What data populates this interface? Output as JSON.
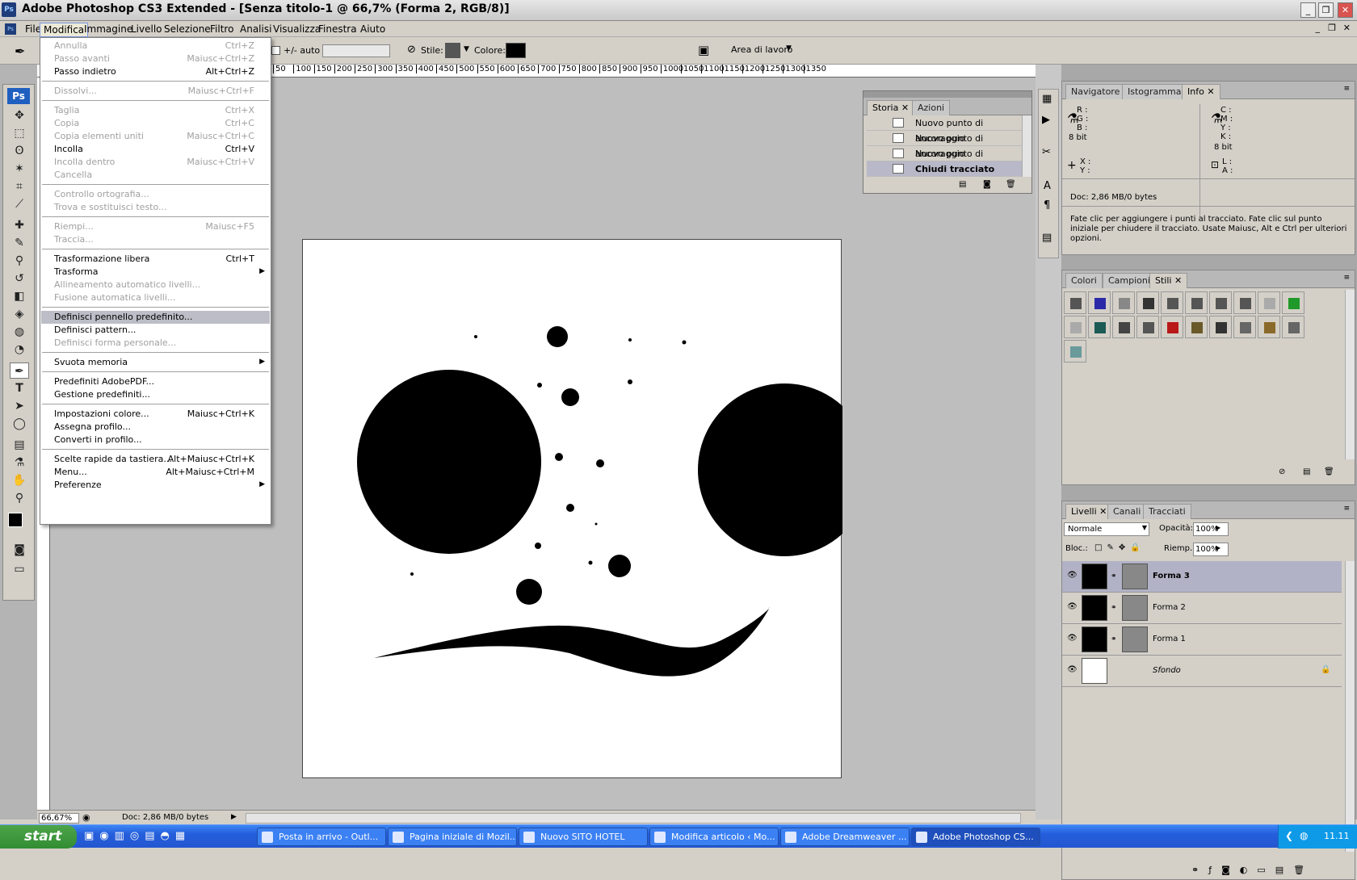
{
  "window": {
    "title": "Adobe Photoshop CS3 Extended - [Senza titolo-1 @ 66,7% (Forma 2, RGB/8)]",
    "app_icon": "Ps"
  },
  "menubar": [
    "File",
    "Modifica",
    "Immagine",
    "Livello",
    "Selezione",
    "Filtro",
    "Analisi",
    "Visualizza",
    "Finestra",
    "Aiuto"
  ],
  "options": {
    "auto_label": "+/- auto",
    "style_label": "Stile:",
    "color_label": "Colore:",
    "workspace_label": "Area di lavoro"
  },
  "ruler_ticks": [
    "50",
    "100",
    "150",
    "200",
    "250",
    "300",
    "350",
    "400",
    "450",
    "500",
    "550",
    "600",
    "650",
    "700",
    "750",
    "800",
    "850",
    "900",
    "950",
    "1000",
    "1050",
    "1100",
    "1150",
    "1200",
    "1250",
    "1300",
    "1350"
  ],
  "edit_menu": [
    {
      "label": "Annulla",
      "shortcut": "Ctrl+Z",
      "disabled": true
    },
    {
      "label": "Passo avanti",
      "shortcut": "Maiusc+Ctrl+Z",
      "disabled": true
    },
    {
      "label": "Passo indietro",
      "shortcut": "Alt+Ctrl+Z",
      "disabled": false
    },
    {
      "label": "Dissolvi...",
      "shortcut": "Maiusc+Ctrl+F",
      "disabled": true
    },
    {
      "label": "Taglia",
      "shortcut": "Ctrl+X",
      "disabled": true
    },
    {
      "label": "Copia",
      "shortcut": "Ctrl+C",
      "disabled": true
    },
    {
      "label": "Copia elementi uniti",
      "shortcut": "Maiusc+Ctrl+C",
      "disabled": true
    },
    {
      "label": "Incolla",
      "shortcut": "Ctrl+V",
      "disabled": false
    },
    {
      "label": "Incolla dentro",
      "shortcut": "Maiusc+Ctrl+V",
      "disabled": true
    },
    {
      "label": "Cancella",
      "shortcut": "",
      "disabled": true
    },
    {
      "label": "Controllo ortografia...",
      "shortcut": "",
      "disabled": true
    },
    {
      "label": "Trova e sostituisci testo...",
      "shortcut": "",
      "disabled": true
    },
    {
      "label": "Riempi...",
      "shortcut": "Maiusc+F5",
      "disabled": true
    },
    {
      "label": "Traccia...",
      "shortcut": "",
      "disabled": true
    },
    {
      "label": "Trasformazione libera",
      "shortcut": "Ctrl+T",
      "disabled": false
    },
    {
      "label": "Trasforma",
      "shortcut": "",
      "disabled": false,
      "submenu": true
    },
    {
      "label": "Allineamento automatico livelli...",
      "shortcut": "",
      "disabled": true
    },
    {
      "label": "Fusione automatica livelli...",
      "shortcut": "",
      "disabled": true
    },
    {
      "label": "Definisci pennello predefinito...",
      "shortcut": "",
      "disabled": false,
      "highlight": true
    },
    {
      "label": "Definisci pattern...",
      "shortcut": "",
      "disabled": false
    },
    {
      "label": "Definisci forma personale...",
      "shortcut": "",
      "disabled": true
    },
    {
      "label": "Svuota memoria",
      "shortcut": "",
      "disabled": false,
      "submenu": true
    },
    {
      "label": "Predefiniti AdobePDF...",
      "shortcut": "",
      "disabled": false
    },
    {
      "label": "Gestione predefiniti...",
      "shortcut": "",
      "disabled": false
    },
    {
      "label": "Impostazioni colore...",
      "shortcut": "Maiusc+Ctrl+K",
      "disabled": false
    },
    {
      "label": "Assegna profilo...",
      "shortcut": "",
      "disabled": false
    },
    {
      "label": "Converti in profilo...",
      "shortcut": "",
      "disabled": false
    },
    {
      "label": "Scelte rapide da tastiera...",
      "shortcut": "Alt+Maiusc+Ctrl+K",
      "disabled": false
    },
    {
      "label": "Menu...",
      "shortcut": "Alt+Maiusc+Ctrl+M",
      "disabled": false
    },
    {
      "label": "Preferenze",
      "shortcut": "",
      "disabled": false,
      "submenu": true
    }
  ],
  "history": {
    "tabs": [
      "Storia",
      "Azioni"
    ],
    "items": [
      "Nuovo punto di ancoraggio",
      "Nuovo punto di ancoraggio",
      "Nuovo punto di ancoraggio",
      "Chiudi tracciato"
    ]
  },
  "info": {
    "tabs": [
      "Navigatore",
      "Istogramma",
      "Info"
    ],
    "left_channels": [
      "R :",
      "G :",
      "B :"
    ],
    "right_channels": [
      "C :",
      "M :",
      "Y :",
      "K :"
    ],
    "left_bits": "8 bit",
    "right_bits": "8 bit",
    "xy": [
      "X :",
      "Y :"
    ],
    "la": [
      "L :",
      "A :"
    ],
    "doc": "Doc: 2,86 MB/0 bytes",
    "hint": "Fate clic per aggiungere i punti al tracciato. Fate clic sul punto iniziale per chiudere il tracciato. Usate Maiusc, Alt e Ctrl per ulteriori opzioni."
  },
  "styles_panel": {
    "tabs": [
      "Colori",
      "Campioni",
      "Stili"
    ],
    "swatches": [
      "#555555",
      "#2a2aa8",
      "#888888",
      "#333333",
      "#555555",
      "#555555",
      "#555555",
      "#555555",
      "#aaaaaa",
      "#1f9a2a",
      "#aaaaaa",
      "#1c5a55",
      "#444444",
      "#555555",
      "#b81818",
      "#6a5a2a",
      "#333333",
      "#666666",
      "#8a6a2a",
      "#666666",
      "#6a9a9a"
    ]
  },
  "layers": {
    "tabs": [
      "Livelli",
      "Canali",
      "Tracciati"
    ],
    "blend_mode": "Normale",
    "opacity_label": "Opacità:",
    "opacity": "100%",
    "lock_label": "Bloc.:",
    "fill_label": "Riemp.:",
    "fill": "100%",
    "items": [
      {
        "name": "Forma 3",
        "selected": true
      },
      {
        "name": "Forma 2",
        "selected": false
      },
      {
        "name": "Forma 1",
        "selected": false
      },
      {
        "name": "Sfondo",
        "selected": false
      }
    ]
  },
  "status": {
    "zoom": "66,67%",
    "doc": "Doc: 2,86 MB/0 bytes"
  },
  "taskbar": {
    "start": "start",
    "buttons": [
      "Posta in arrivo - Outl...",
      "Pagina iniziale di Mozil...",
      "Nuovo SITO HOTEL",
      "Modifica articolo ‹ Mo...",
      "Adobe Dreamweaver ...",
      "Adobe Photoshop CS..."
    ],
    "clock": "11.11"
  }
}
